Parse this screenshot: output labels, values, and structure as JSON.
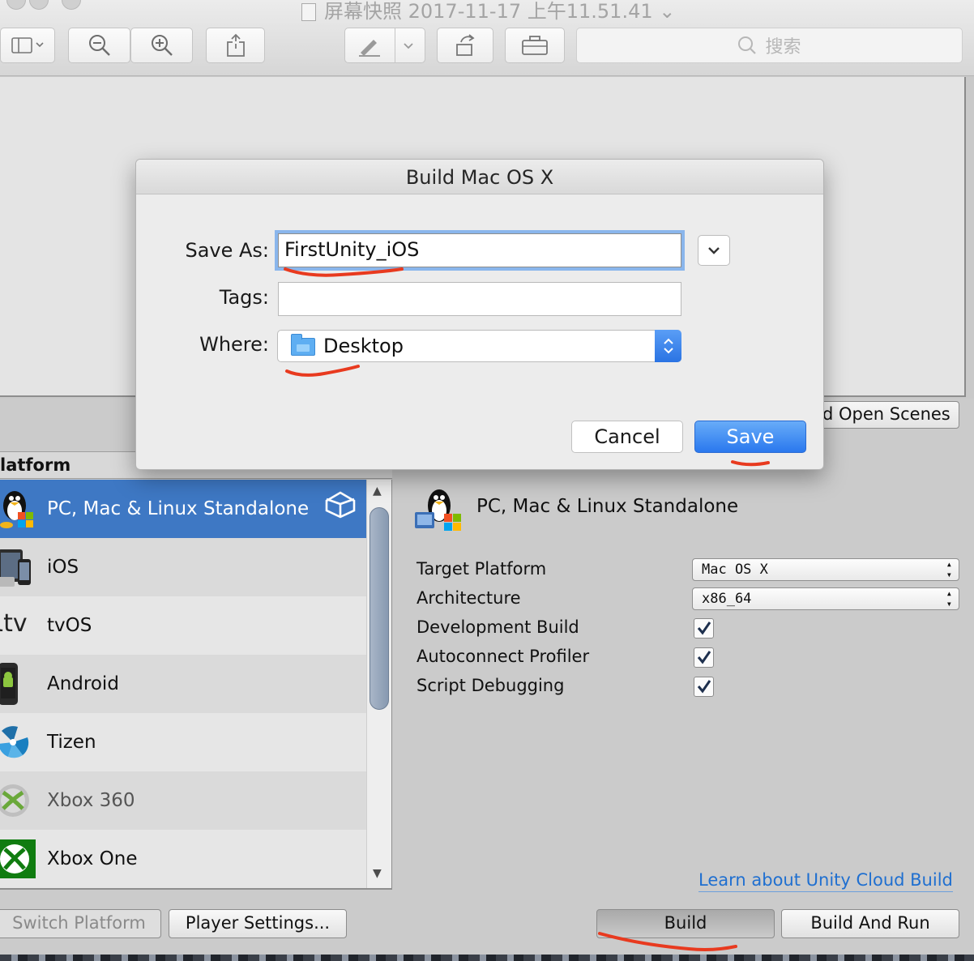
{
  "window": {
    "title": "屏幕快照 2017-11-17 上午11.51.41",
    "search_placeholder": "搜索"
  },
  "dialog": {
    "title": "Build Mac OS X",
    "save_as_label": "Save As:",
    "save_as_value": "FirstUnity_iOS",
    "tags_label": "Tags:",
    "tags_value": "",
    "where_label": "Where:",
    "where_value": "Desktop",
    "cancel_label": "Cancel",
    "save_label": "Save"
  },
  "build_settings": {
    "add_open_scenes_label": "d Open Scenes",
    "platform_header": "latform",
    "platforms": [
      {
        "label": "PC, Mac & Linux Standalone",
        "selected": true
      },
      {
        "label": "iOS"
      },
      {
        "label": "tvOS"
      },
      {
        "label": "Android"
      },
      {
        "label": "Tizen"
      },
      {
        "label": "Xbox 360"
      },
      {
        "label": "Xbox One"
      }
    ],
    "detail_title": "PC, Mac & Linux Standalone",
    "props": {
      "target_platform_label": "Target Platform",
      "target_platform_value": "Mac OS X",
      "architecture_label": "Architecture",
      "architecture_value": "x86_64",
      "development_build_label": "Development Build",
      "development_build_checked": true,
      "autoconnect_profiler_label": "Autoconnect Profiler",
      "autoconnect_profiler_checked": true,
      "script_debugging_label": "Script Debugging",
      "script_debugging_checked": true
    },
    "cloud_build_link": "Learn about Unity Cloud Build",
    "switch_platform_label": "Switch Platform",
    "player_settings_label": "Player Settings...",
    "build_label": "Build",
    "build_and_run_label": "Build And Run"
  },
  "colors": {
    "selection_blue": "#3e78c4",
    "annotation_red": "#e83a1f",
    "save_button_blue": "#2a78ee"
  }
}
